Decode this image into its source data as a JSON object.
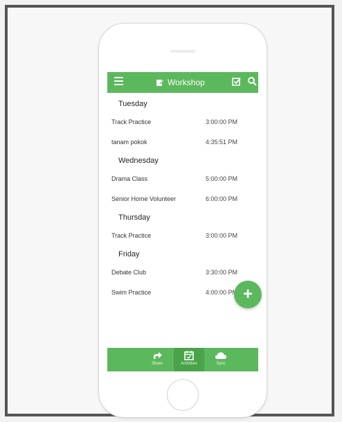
{
  "app": {
    "title": "Workshop",
    "colors": {
      "primary": "#5cb85c",
      "primary_dark": "#4aa34a"
    }
  },
  "header_icons": [
    "menu-icon",
    "edit-icon",
    "checkbox-icon",
    "search-icon"
  ],
  "days": [
    {
      "day": "Tuesday",
      "items": [
        {
          "name": "Track Practice",
          "time": "3:00:00 PM"
        },
        {
          "name": "tanam pokok",
          "time": "4:35:51 PM"
        }
      ]
    },
    {
      "day": "Wednesday",
      "items": [
        {
          "name": "Drama Class",
          "time": "5:00:00 PM"
        },
        {
          "name": "Senior Home Volunteer",
          "time": "6:00:00 PM"
        }
      ]
    },
    {
      "day": "Thursday",
      "items": [
        {
          "name": "Track Practice",
          "time": "3:00:00 PM"
        }
      ]
    },
    {
      "day": "Friday",
      "items": [
        {
          "name": "Debate Club",
          "time": "3:30:00 PM"
        },
        {
          "name": "Swim Practice",
          "time": "4:00:00 PM"
        }
      ]
    }
  ],
  "fab": {
    "label": "+"
  },
  "bottom_tabs": [
    {
      "label": "Share",
      "icon": "share-icon"
    },
    {
      "label": "Activities",
      "icon": "calendar-icon",
      "active": true
    },
    {
      "label": "Sync",
      "icon": "cloud-icon"
    }
  ]
}
